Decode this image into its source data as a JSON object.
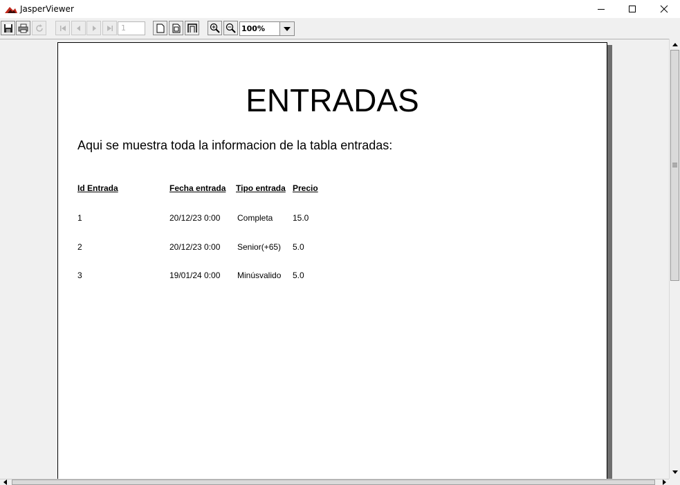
{
  "window": {
    "title": "JasperViewer"
  },
  "toolbar": {
    "page_number": "1",
    "zoom_value": "100%",
    "icons": [
      "save-icon",
      "print-icon",
      "reload-icon",
      "first-page-icon",
      "previous-page-icon",
      "next-page-icon",
      "last-page-icon",
      "actual-size-icon",
      "fit-page-icon",
      "fit-width-icon",
      "zoom-in-icon",
      "zoom-out-icon",
      "chevron-down-icon"
    ]
  },
  "report": {
    "title": "ENTRADAS",
    "subtitle": "Aqui se muestra toda la informacion de la tabla entradas:",
    "columns": [
      "Id Entrada",
      "Fecha entrada",
      "Tipo entrada",
      "Precio"
    ],
    "rows": [
      [
        "1",
        "20/12/23 0:00",
        "Completa",
        "15.0"
      ],
      [
        "2",
        "20/12/23 0:00",
        "Senior(+65)",
        "5.0"
      ],
      [
        "3",
        "19/01/24 0:00",
        "Minúsvalido",
        "5.0"
      ]
    ]
  },
  "colors": {
    "window_bg": "#ffffff",
    "toolbar_bg": "#f0f0f0",
    "viewport_bg": "#f0f0f0",
    "page_shadow": "#6e6e6e",
    "logo_red": "#c0281c"
  }
}
